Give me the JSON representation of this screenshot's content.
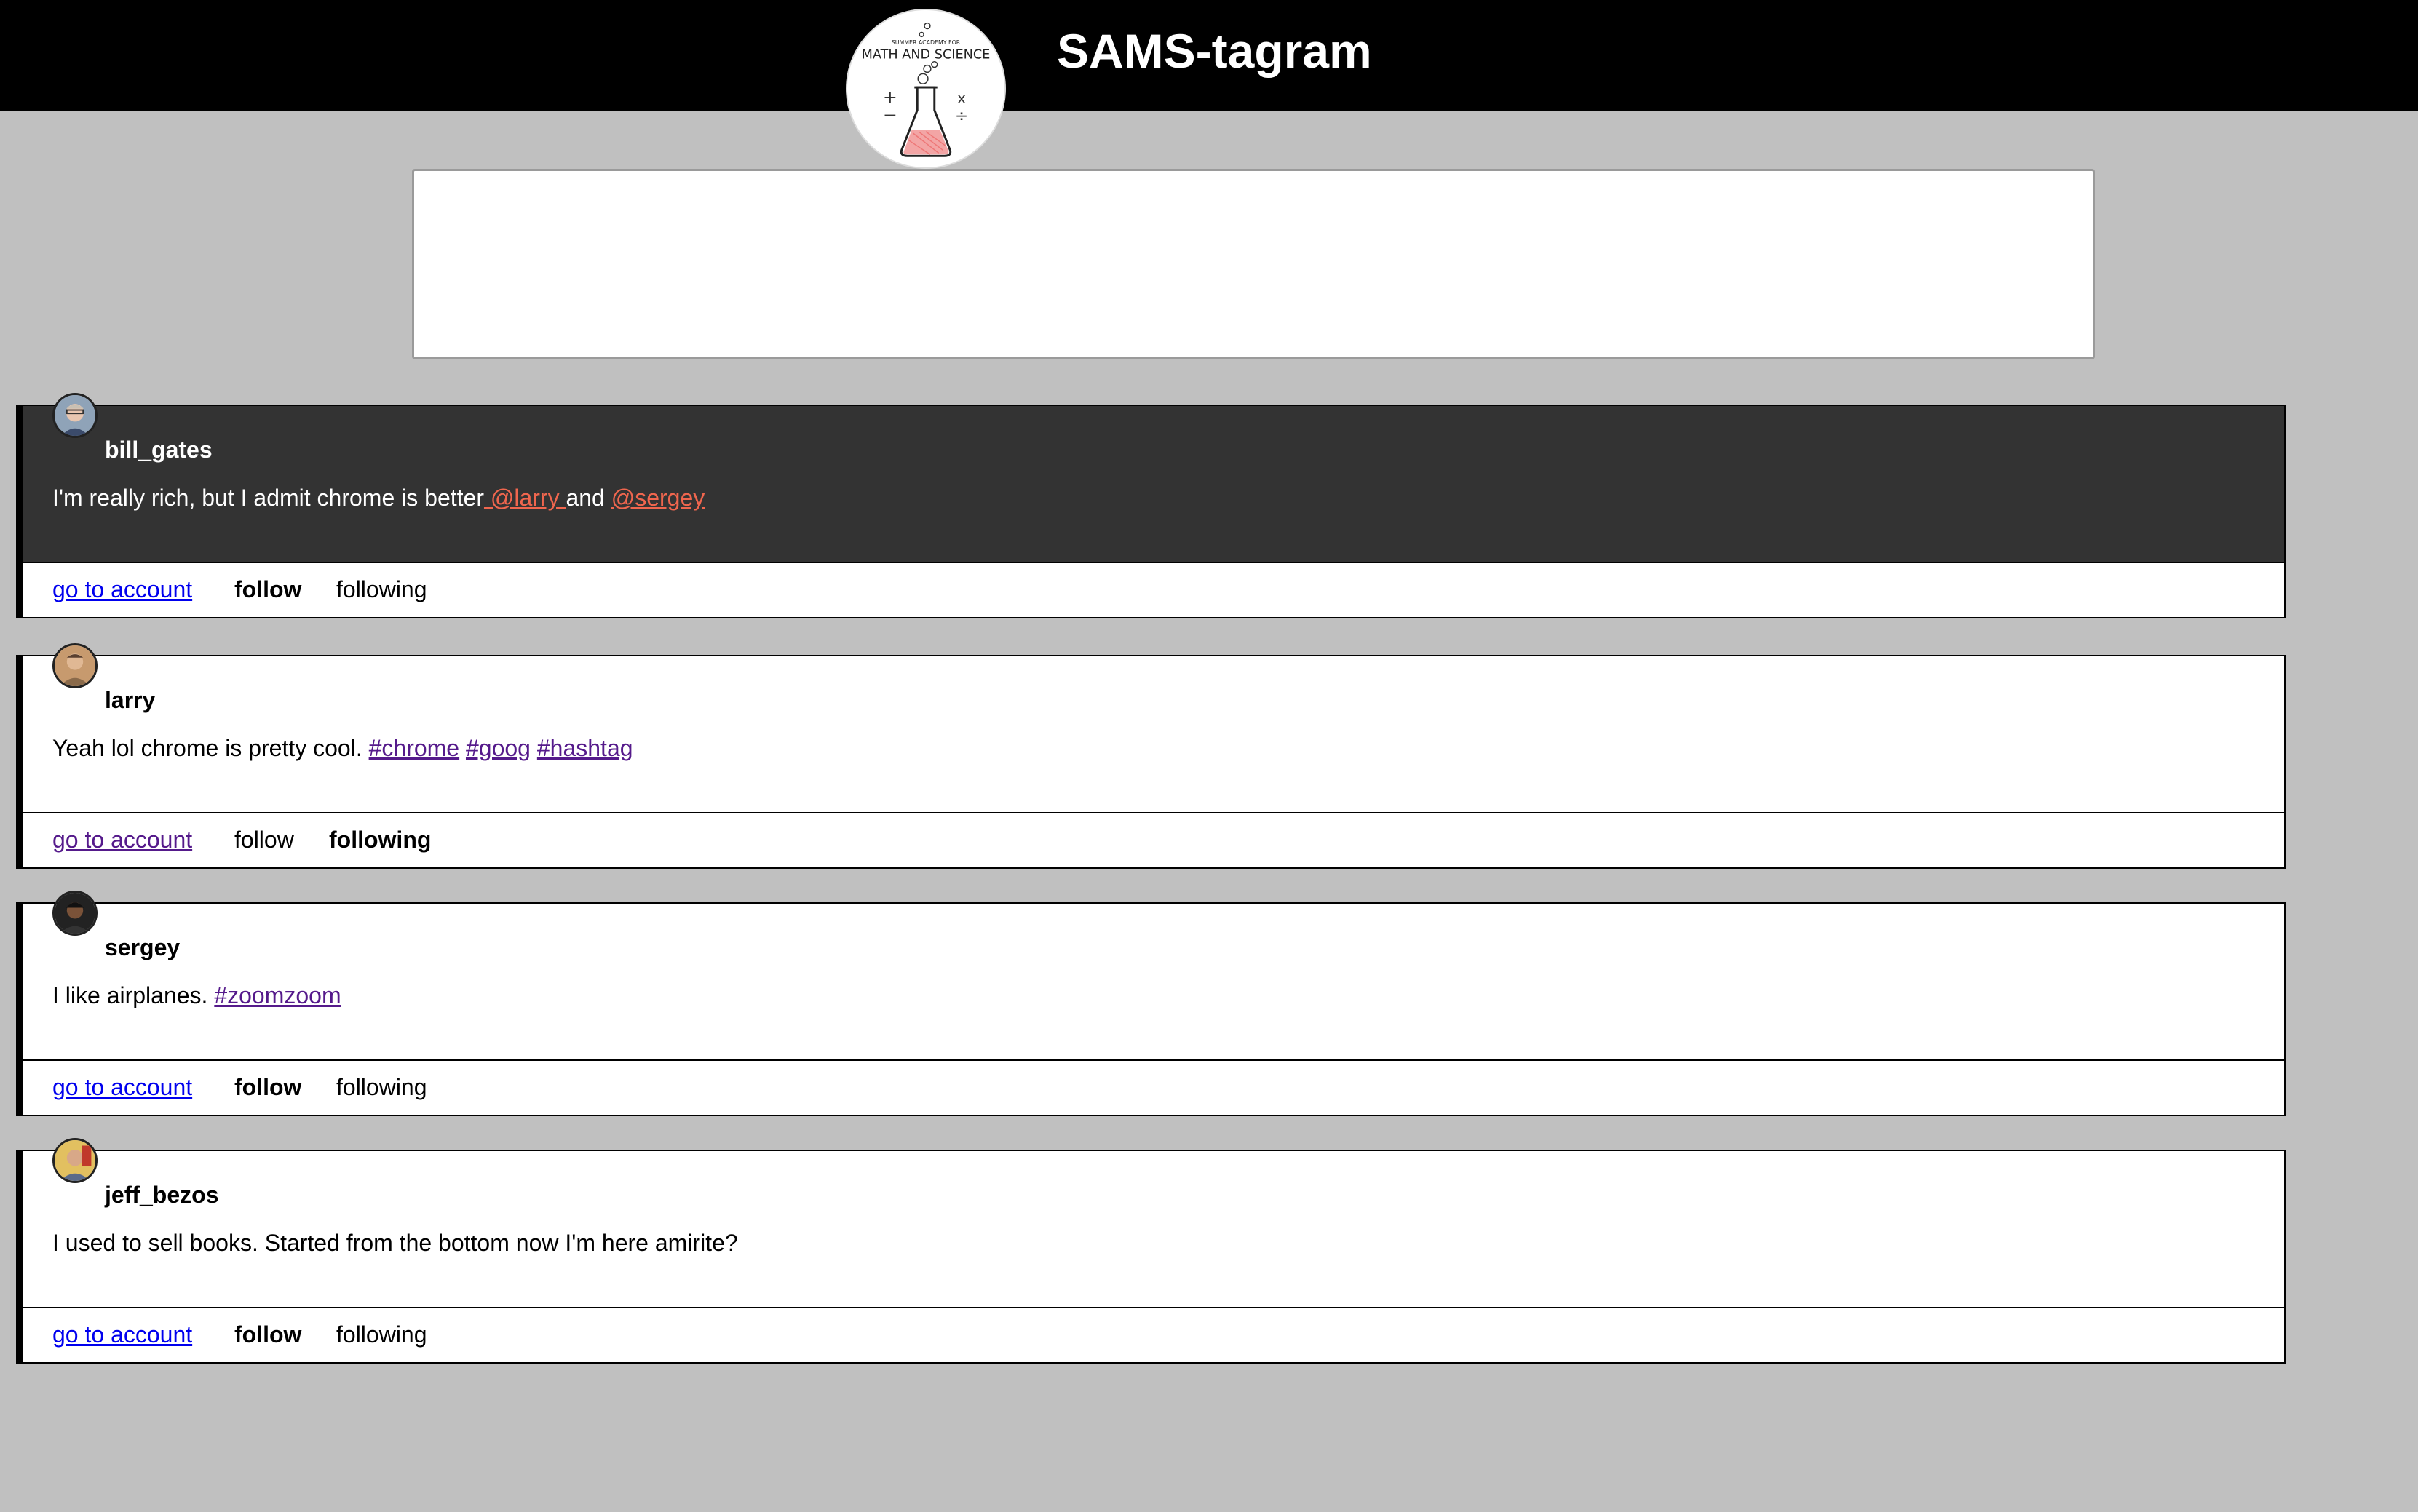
{
  "site": {
    "title": "SAMS-tagram",
    "logo_text": "SUMMER ACADEMY FOR MATH AND SCIENCE"
  },
  "compose": {
    "value": ""
  },
  "actions": {
    "go_to_account": "go to account ",
    "follow": "follow",
    "following": "following"
  },
  "posts": [
    {
      "username": "bill_gates",
      "text": "I'm really rich, but I admit chrome is better",
      "tag1": " @larry ",
      "between": "and ",
      "tag2": "@sergey",
      "tag3": "",
      "highlighted": true,
      "state": "follow"
    },
    {
      "username": "larry",
      "text": "Yeah lol chrome is pretty cool. ",
      "tag1": "#chrome",
      "between": " ",
      "tag2": "#goog",
      "between2": " ",
      "tag3": "#hashtag",
      "highlighted": false,
      "state": "following"
    },
    {
      "username": "sergey",
      "text": "I like airplanes. ",
      "tag1": "#zoomzoom",
      "highlighted": false,
      "state": "follow"
    },
    {
      "username": "jeff_bezos",
      "text": "I used to sell books. Started from the bottom now I'm here amirite?",
      "highlighted": false,
      "state": "follow"
    }
  ],
  "colors": {
    "background": "#c0c0c0",
    "header": "#000000",
    "highlight_post": "#333333",
    "mention": "#f0664e",
    "hashtag": "#551a8b",
    "link": "#0000ee"
  }
}
